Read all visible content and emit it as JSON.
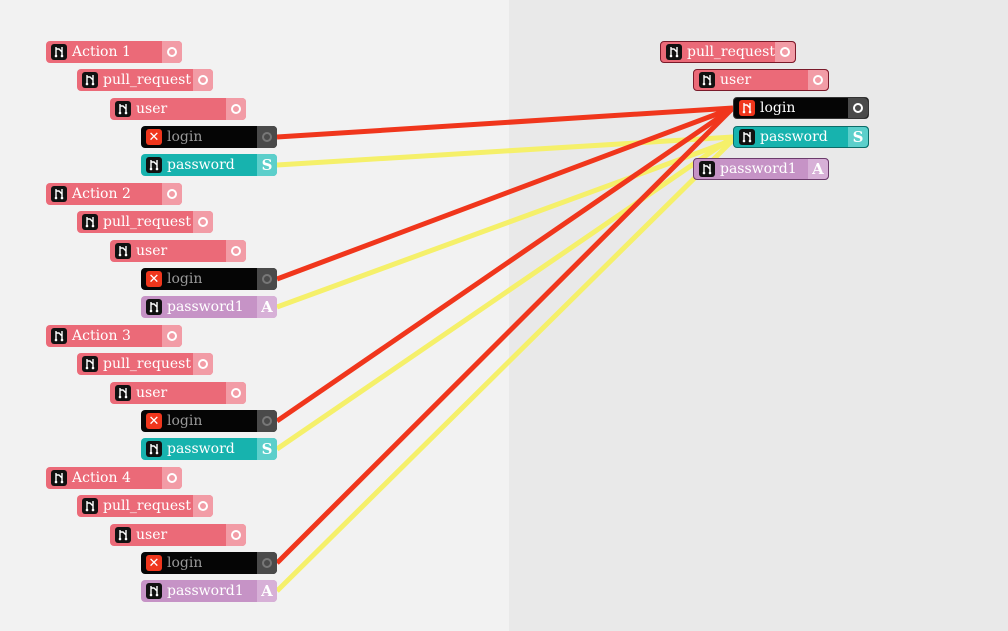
{
  "colors": {
    "failure_wire": "#f0361c",
    "success_wire": "#f5f06a",
    "pink": "#eb6a78",
    "teal": "#17b3ae",
    "purple": "#c693c6",
    "black": "#050505"
  },
  "actions": [
    {
      "title": "Action 1",
      "pull_request": "pull_request",
      "user": "user",
      "login": "login",
      "second": "password",
      "second_type": "teal",
      "second_tail": "S"
    },
    {
      "title": "Action 2",
      "pull_request": "pull_request",
      "user": "user",
      "login": "login",
      "second": "password1",
      "second_type": "purple",
      "second_tail": "A"
    },
    {
      "title": "Action 3",
      "pull_request": "pull_request",
      "user": "user",
      "login": "login",
      "second": "password",
      "second_type": "teal",
      "second_tail": "S"
    },
    {
      "title": "Action 4",
      "pull_request": "pull_request",
      "user": "user",
      "login": "login",
      "second": "password1",
      "second_type": "purple",
      "second_tail": "A"
    }
  ],
  "target": {
    "pull_request": "pull_request",
    "user": "user",
    "login": "login",
    "password": "password",
    "password_tail": "S",
    "password1": "password1",
    "password1_tail": "A"
  },
  "icons": {
    "branch": "git-branch-icon",
    "fail": "x-icon",
    "port": "circle-port-icon"
  }
}
